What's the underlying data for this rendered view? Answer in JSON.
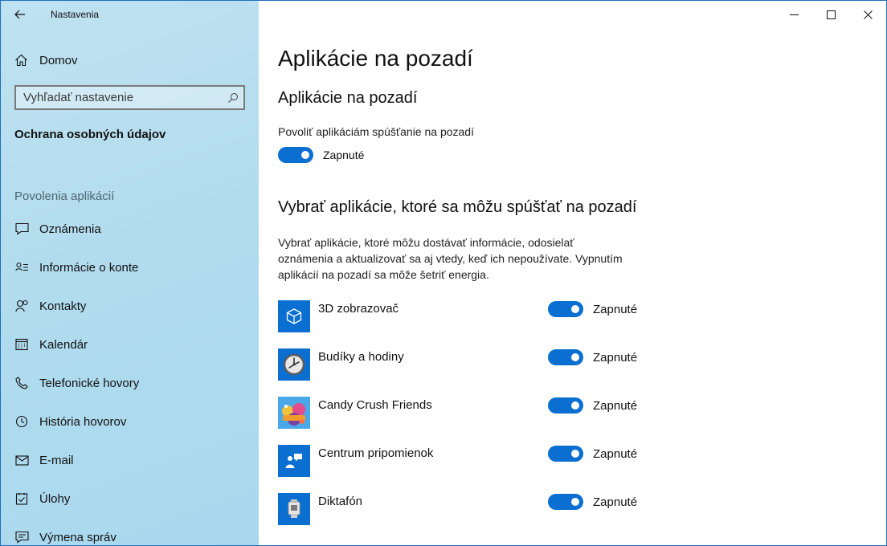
{
  "window": {
    "title": "Nastavenia"
  },
  "sidebar": {
    "home_label": "Domov",
    "search_placeholder": "Vyhľadať nastavenie",
    "section_title": "Ochrana osobných údajov",
    "group_title": "Povolenia aplikácií",
    "items": [
      {
        "label": "Oznámenia",
        "icon": "notification-icon"
      },
      {
        "label": "Informácie o konte",
        "icon": "account-info-icon"
      },
      {
        "label": "Kontakty",
        "icon": "contacts-icon"
      },
      {
        "label": "Kalendár",
        "icon": "calendar-icon"
      },
      {
        "label": "Telefonické hovory",
        "icon": "phone-icon"
      },
      {
        "label": "História hovorov",
        "icon": "history-icon"
      },
      {
        "label": "E-mail",
        "icon": "mail-icon"
      },
      {
        "label": "Úlohy",
        "icon": "tasks-icon"
      },
      {
        "label": "Výmena správ",
        "icon": "messaging-icon"
      }
    ]
  },
  "main": {
    "page_title": "Aplikácie na pozadí",
    "section1_title": "Aplikácie na pozadí",
    "allow_label": "Povoliť aplikáciám spúšťanie na pozadí",
    "allow_state": "Zapnuté",
    "section2_title": "Vybrať aplikácie, ktoré sa môžu spúšťať na pozadí",
    "description": "Vybrať aplikácie, ktoré môžu dostávať informácie, odosielať oznámenia a aktualizovať sa aj vtedy, keď ich nepoužívate. Vypnutím aplikácií na pozadí sa môže šetriť energia.",
    "apps": [
      {
        "name": "3D zobrazovač",
        "state": "Zapnuté",
        "icon": "cube-icon"
      },
      {
        "name": "Budíky a hodiny",
        "state": "Zapnuté",
        "icon": "clock-icon"
      },
      {
        "name": "Candy Crush Friends",
        "state": "Zapnuté",
        "icon": "candy-crush-icon"
      },
      {
        "name": "Centrum pripomienok",
        "state": "Zapnuté",
        "icon": "feedback-hub-icon"
      },
      {
        "name": "Diktafón",
        "state": "Zapnuté",
        "icon": "voice-recorder-icon"
      }
    ]
  },
  "colors": {
    "accent": "#0a6fd1",
    "sidebar_bg": "#b2dcee"
  }
}
